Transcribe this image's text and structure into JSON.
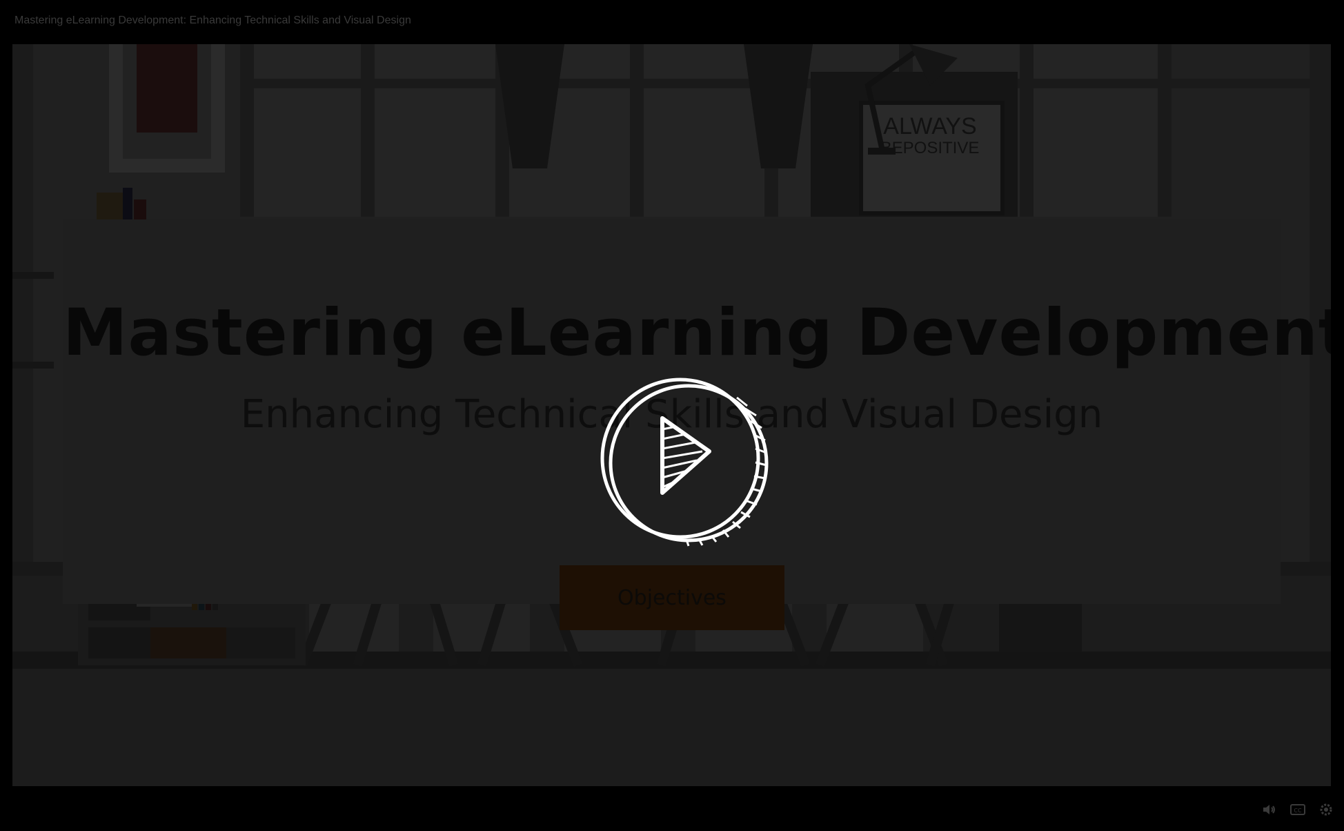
{
  "player": {
    "course_title": "Mastering eLearning Development: Enhancing Technical Skills and Visual Design"
  },
  "slide": {
    "title": "Mastering eLearning Development",
    "subtitle": "Enhancing Technical Skills and Visual Design",
    "objectives_button_label": "Objectives",
    "poster_text_line1": "ALWAYS",
    "poster_text_line2": "BEPOSITIVE"
  },
  "overlay": {
    "play_icon": "play-icon",
    "dimmed": true
  },
  "controls": {
    "volume_icon": "volume-icon",
    "captions_icon": "captions-icon",
    "settings_icon": "settings-icon"
  },
  "colors": {
    "background": "#000000",
    "stage_dimmed": "#202020",
    "objectives_button": "#1e1004",
    "play_icon_stroke": "#ffffff"
  }
}
